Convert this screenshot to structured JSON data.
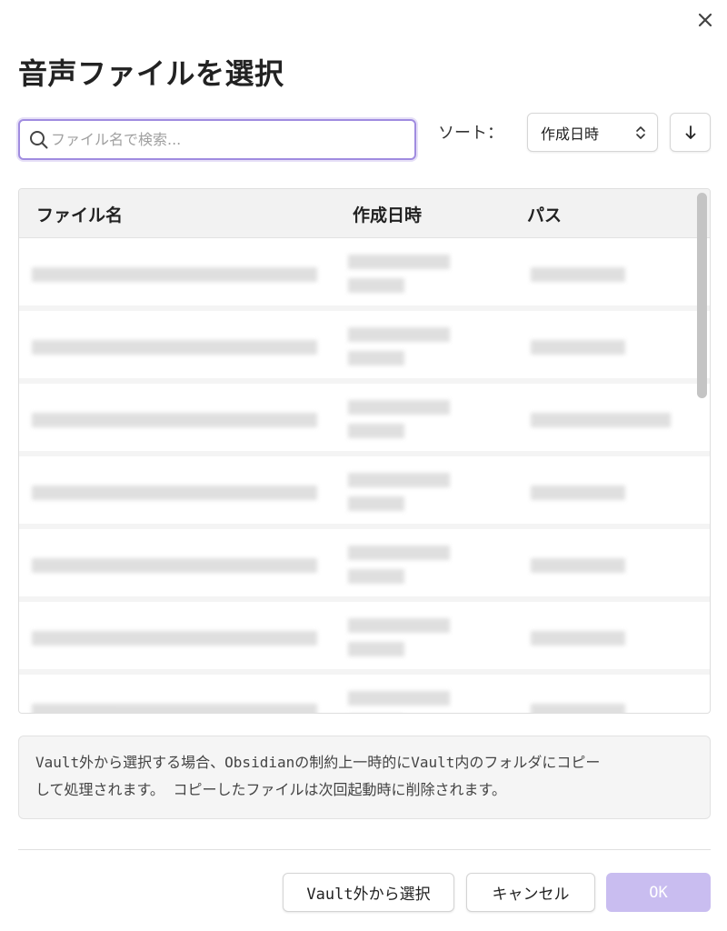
{
  "dialog": {
    "title": "音声ファイルを選択",
    "close_icon": "close-icon"
  },
  "search": {
    "placeholder": "ファイル名で検索...",
    "value": "",
    "icon": "search-icon"
  },
  "sort": {
    "label": "ソート：",
    "selected": "作成日時",
    "direction_icon": "arrow-down-icon"
  },
  "table": {
    "headers": [
      "ファイル名",
      "作成日時",
      "パス"
    ],
    "row_count_visible": 7
  },
  "notice": {
    "line1": "Vault外から選択する場合、Obsidianの制約上一時的にVault内のフォルダにコピー",
    "line2": "して処理されます。 コピーしたファイルは次回起動時に削除されます。"
  },
  "buttons": {
    "select_outside": "Vault外から選択",
    "cancel": "キャンセル",
    "ok": "OK"
  },
  "colors": {
    "accent": "#a08ce0",
    "ok_button": "#c9bdf0"
  }
}
